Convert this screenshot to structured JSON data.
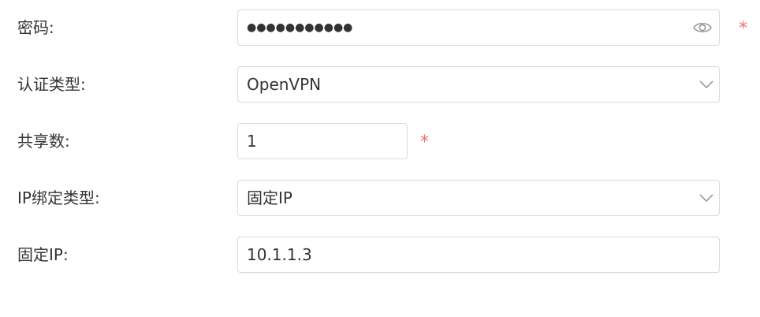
{
  "form": {
    "password": {
      "label": "密码:",
      "value": "●●●●●●●●●●●",
      "required_mark": "*",
      "icon": "eye-icon"
    },
    "auth_type": {
      "label": "认证类型:",
      "selected": "OpenVPN",
      "icon": "chevron-down-icon"
    },
    "share_count": {
      "label": "共享数:",
      "value": "1",
      "required_mark": "*"
    },
    "ip_binding_type": {
      "label": "IP绑定类型:",
      "selected": "固定IP",
      "icon": "chevron-down-icon"
    },
    "fixed_ip": {
      "label": "固定IP:",
      "value": "10.1.1.3"
    }
  },
  "colors": {
    "required": "#f56c6c",
    "border": "#d9d9d9",
    "text": "#333333",
    "icon": "#999999"
  }
}
